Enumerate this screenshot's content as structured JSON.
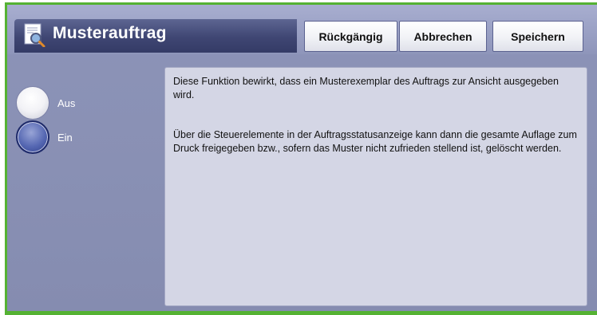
{
  "header": {
    "title": "Musterauftrag",
    "title_icon": "document-magnifier-icon",
    "buttons": {
      "undo_label": "Rückgängig",
      "cancel_label": "Abbrechen",
      "save_label": "Speichern"
    }
  },
  "options": {
    "items": [
      {
        "label": "Aus",
        "selected": false
      },
      {
        "label": "Ein",
        "selected": true
      }
    ]
  },
  "description": {
    "paragraph_1": "Diese Funktion bewirkt, dass ein Musterexemplar des Auftrags zur Ansicht ausgegeben wird.",
    "paragraph_2": "Über die Steuerelemente in der Auftragsstatusanzeige kann dann die gesamte Auflage zum Druck freigegeben bzw., sofern das Muster nicht zufrieden stellend ist, gelöscht werden."
  },
  "colors": {
    "frame_accent": "#55b233",
    "title_bar": "#3f4673",
    "background": "#8a91b5",
    "description_panel": "#d4d6e5",
    "radio_selected": "#5567b2"
  }
}
